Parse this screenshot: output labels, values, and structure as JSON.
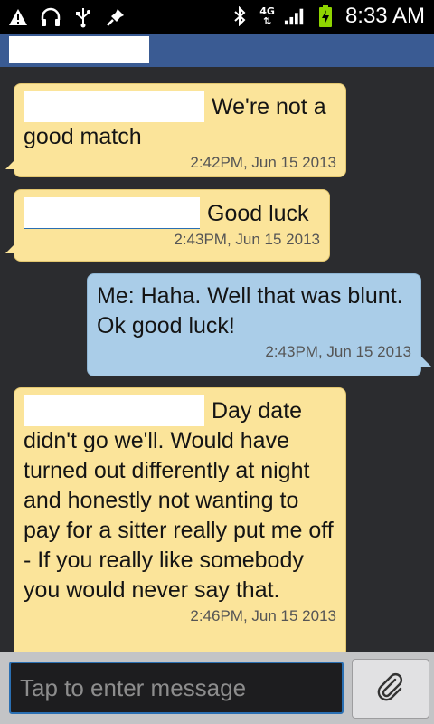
{
  "status_bar": {
    "icons": [
      "warning-icon",
      "headphones-icon",
      "usb-icon",
      "pin-icon",
      "bluetooth-icon",
      "network-4g-icon",
      "signal-icon",
      "battery-charging-icon"
    ],
    "network_label": "4G",
    "time": "8:33 AM"
  },
  "conversation": {
    "messages": [
      {
        "direction": "incoming",
        "text": "We're not a good match",
        "timestamp": "2:42PM, Jun 15 2013"
      },
      {
        "direction": "incoming",
        "text": "Good luck",
        "timestamp": "2:43PM, Jun 15 2013"
      },
      {
        "direction": "outgoing",
        "text": "Me: Haha. Well that was blunt. Ok good luck!",
        "timestamp": "2:43PM, Jun 15 2013"
      },
      {
        "direction": "incoming",
        "text": "Day date didn't go we'll. Would have turned out differently at night and honestly not wanting to pay for a sitter really put me off - If you really like somebody you would never say that.",
        "timestamp": "2:46PM, Jun 15 2013"
      }
    ]
  },
  "compose": {
    "placeholder": "Tap to enter message",
    "attach_icon": "paperclip-icon"
  },
  "colors": {
    "incoming_bubble": "#fbe49a",
    "outgoing_bubble": "#aacde8",
    "header": "#3a5b93",
    "input_border": "#2a6fb2"
  }
}
